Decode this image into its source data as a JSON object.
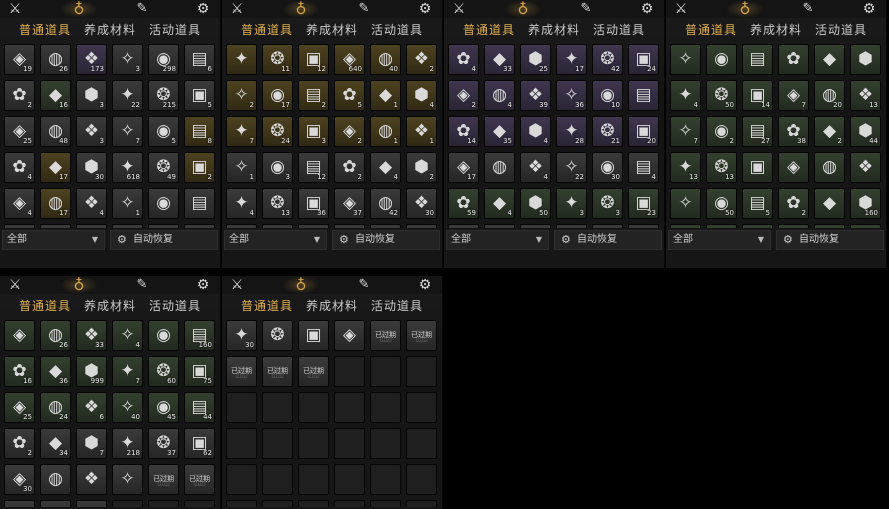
{
  "header_icons": [
    "crossed-swords-icon",
    "pouch-icon",
    "quill-icon",
    "gear-icon"
  ],
  "tabs": [
    "普通道具",
    "养成材料",
    "活动道具"
  ],
  "footer": {
    "filter_label": "全部",
    "restore_label": "自动恢复"
  },
  "expired_label": "已过期",
  "colors": {
    "gray": "#3a3a3a",
    "green": "#33402f",
    "purple": "#40364f",
    "gold": "#4d4220",
    "accent": "#e0b050"
  },
  "panels": [
    {
      "id": "p1",
      "rows": [
        [
          [
            "gray",
            "1",
            "19"
          ],
          [
            "gray",
            "",
            "26"
          ],
          [
            "purple",
            "",
            "173"
          ],
          [
            "gray",
            "",
            "3"
          ],
          [
            "gray",
            "",
            "298"
          ],
          [
            "gray",
            "",
            "6"
          ]
        ],
        [
          [
            "gray",
            "",
            "2"
          ],
          [
            "green",
            "",
            "16"
          ],
          [
            "gray",
            "",
            "3"
          ],
          [
            "gray",
            "",
            "22"
          ],
          [
            "gray",
            "",
            "215"
          ],
          [
            "gray",
            "",
            "5"
          ]
        ],
        [
          [
            "gray",
            "",
            "25"
          ],
          [
            "gray",
            "",
            "48"
          ],
          [
            "gray",
            "",
            "3"
          ],
          [
            "gray",
            "",
            "7"
          ],
          [
            "gray",
            "",
            "5"
          ],
          [
            "gold",
            "",
            "8"
          ]
        ],
        [
          [
            "gray",
            "",
            "4"
          ],
          [
            "gold",
            "",
            "17"
          ],
          [
            "gray",
            "",
            "30"
          ],
          [
            "gray",
            "",
            "618"
          ],
          [
            "gray",
            "",
            "49"
          ],
          [
            "gold",
            "",
            "2"
          ]
        ],
        [
          [
            "gray",
            "",
            "4"
          ],
          [
            "gold",
            "",
            "17"
          ],
          [
            "gray",
            "",
            "4"
          ],
          [
            "gray",
            "",
            "1"
          ],
          [
            "gray",
            "",
            ""
          ],
          [
            "gray",
            "",
            ""
          ]
        ],
        [
          [
            "gray",
            "",
            ""
          ],
          [
            "gray",
            "",
            ""
          ],
          [
            "gray",
            "",
            ""
          ],
          [
            "gray",
            "",
            ""
          ],
          [
            "gray",
            "",
            ""
          ],
          [
            "gray",
            "",
            ""
          ]
        ]
      ]
    },
    {
      "id": "p2",
      "rows": [
        [
          [
            "gold",
            "",
            ""
          ],
          [
            "gold",
            "",
            "11"
          ],
          [
            "gold",
            "",
            "12"
          ],
          [
            "gold",
            "",
            "640"
          ],
          [
            "gold",
            "",
            "40"
          ],
          [
            "gold",
            "",
            "2"
          ]
        ],
        [
          [
            "gold",
            "",
            "2"
          ],
          [
            "gold",
            "",
            "17"
          ],
          [
            "gold",
            "",
            "2"
          ],
          [
            "gold",
            "",
            "5"
          ],
          [
            "gold",
            "",
            "1"
          ],
          [
            "gold",
            "",
            "4"
          ]
        ],
        [
          [
            "gold",
            "",
            "7"
          ],
          [
            "gold",
            "",
            "24"
          ],
          [
            "gold",
            "",
            "3"
          ],
          [
            "gold",
            "",
            "2"
          ],
          [
            "gold",
            "",
            "1"
          ],
          [
            "gold",
            "",
            "1"
          ]
        ],
        [
          [
            "gray",
            "",
            "1"
          ],
          [
            "gray",
            "",
            "3"
          ],
          [
            "gray",
            "",
            "12"
          ],
          [
            "gray",
            "",
            "2"
          ],
          [
            "gray",
            "",
            "4"
          ],
          [
            "gray",
            "",
            "2"
          ]
        ],
        [
          [
            "gray",
            "",
            "4"
          ],
          [
            "gray",
            "",
            "13"
          ],
          [
            "gray",
            "",
            "36"
          ],
          [
            "gray",
            "",
            "37"
          ],
          [
            "gray",
            "",
            "42"
          ],
          [
            "gray",
            "",
            "30"
          ]
        ],
        [
          [
            "gray",
            "",
            "4"
          ],
          [
            "gray",
            "",
            "3"
          ],
          [
            "gray",
            "",
            "5"
          ],
          [
            "gray",
            "",
            "4"
          ],
          [
            "gray",
            "",
            "4"
          ],
          [
            "gray",
            "",
            "10"
          ]
        ]
      ]
    },
    {
      "id": "p3",
      "rows": [
        [
          [
            "purple",
            "",
            "4"
          ],
          [
            "purple",
            "",
            "33"
          ],
          [
            "purple",
            "",
            "25"
          ],
          [
            "purple",
            "",
            "17"
          ],
          [
            "purple",
            "",
            "42"
          ],
          [
            "purple",
            "",
            "24"
          ]
        ],
        [
          [
            "purple",
            "",
            "2"
          ],
          [
            "purple",
            "",
            "4"
          ],
          [
            "purple",
            "",
            "39"
          ],
          [
            "purple",
            "",
            "36"
          ],
          [
            "purple",
            "",
            "10"
          ],
          [
            "purple",
            "",
            ""
          ]
        ],
        [
          [
            "purple",
            "",
            "14"
          ],
          [
            "purple",
            "",
            "35"
          ],
          [
            "purple",
            "",
            "4"
          ],
          [
            "purple",
            "",
            "28"
          ],
          [
            "purple",
            "",
            "21"
          ],
          [
            "purple",
            "",
            "20"
          ]
        ],
        [
          [
            "gray",
            "",
            "17"
          ],
          [
            "gray",
            "",
            ""
          ],
          [
            "gray",
            "",
            "4"
          ],
          [
            "gray",
            "",
            "22"
          ],
          [
            "gray",
            "",
            "30"
          ],
          [
            "gray",
            "",
            "4"
          ]
        ],
        [
          [
            "green",
            "",
            "59"
          ],
          [
            "green",
            "",
            "4"
          ],
          [
            "green",
            "",
            "50"
          ],
          [
            "green",
            "",
            "3"
          ],
          [
            "green",
            "",
            "3"
          ],
          [
            "green",
            "",
            "23"
          ]
        ],
        [
          [
            "gray",
            "",
            ""
          ],
          [
            "gray",
            "",
            ""
          ],
          [
            "gray",
            "",
            ""
          ],
          [
            "gray",
            "",
            ""
          ],
          [
            "gray",
            "",
            ""
          ],
          [
            "gray",
            "",
            ""
          ]
        ]
      ]
    },
    {
      "id": "p4",
      "rows": [
        [
          [
            "green",
            "",
            ""
          ],
          [
            "green",
            "",
            ""
          ],
          [
            "green",
            "",
            ""
          ],
          [
            "green",
            "",
            ""
          ],
          [
            "green",
            "",
            ""
          ],
          [
            "green",
            "",
            ""
          ]
        ],
        [
          [
            "green",
            "",
            "4"
          ],
          [
            "green",
            "",
            "50"
          ],
          [
            "green",
            "",
            "14"
          ],
          [
            "green",
            "",
            "7"
          ],
          [
            "green",
            "",
            "20"
          ],
          [
            "green",
            "",
            "13"
          ]
        ],
        [
          [
            "green",
            "",
            "7"
          ],
          [
            "green",
            "",
            "2"
          ],
          [
            "green",
            "",
            "27"
          ],
          [
            "green",
            "",
            "38"
          ],
          [
            "green",
            "",
            "2"
          ],
          [
            "green",
            "",
            "44"
          ]
        ],
        [
          [
            "green",
            "",
            "13"
          ],
          [
            "green",
            "",
            "13"
          ],
          [
            "green",
            "",
            ""
          ],
          [
            "green",
            "",
            ""
          ],
          [
            "green",
            "",
            ""
          ],
          [
            "green",
            "",
            ""
          ]
        ],
        [
          [
            "green",
            "",
            ""
          ],
          [
            "green",
            "",
            "50"
          ],
          [
            "green",
            "",
            "5"
          ],
          [
            "green",
            "",
            "2"
          ],
          [
            "green",
            "",
            ""
          ],
          [
            "green",
            "",
            "160"
          ]
        ],
        [
          [
            "green",
            "",
            "16"
          ],
          [
            "green",
            "",
            "36"
          ],
          [
            "green",
            "",
            "999"
          ],
          [
            "green",
            "",
            "7"
          ],
          [
            "green",
            "",
            "60"
          ],
          [
            "green",
            "",
            "75"
          ]
        ]
      ]
    },
    {
      "id": "p5",
      "rows": [
        [
          [
            "green",
            "",
            ""
          ],
          [
            "green",
            "",
            "26"
          ],
          [
            "green",
            "",
            "33"
          ],
          [
            "green",
            "",
            "4"
          ],
          [
            "green",
            "",
            ""
          ],
          [
            "green",
            "",
            "160"
          ]
        ],
        [
          [
            "green",
            "",
            "16"
          ],
          [
            "green",
            "",
            "36"
          ],
          [
            "green",
            "",
            "999"
          ],
          [
            "green",
            "",
            "7"
          ],
          [
            "green",
            "",
            "60"
          ],
          [
            "green",
            "",
            "75"
          ]
        ],
        [
          [
            "green",
            "",
            "25"
          ],
          [
            "green",
            "",
            "24"
          ],
          [
            "green",
            "",
            "6"
          ],
          [
            "green",
            "",
            "40"
          ],
          [
            "green",
            "",
            "45"
          ],
          [
            "green",
            "",
            "44"
          ]
        ],
        [
          [
            "gray",
            "",
            "2"
          ],
          [
            "gray",
            "",
            "34"
          ],
          [
            "gray",
            "",
            "7"
          ],
          [
            "gray",
            "",
            "218"
          ],
          [
            "gray",
            "",
            "37"
          ],
          [
            "gray",
            "",
            "62"
          ]
        ],
        [
          [
            "gray",
            "",
            "30"
          ],
          [
            "gray",
            "",
            ""
          ],
          [
            "gray",
            "",
            ""
          ],
          [
            "gray",
            "",
            ""
          ],
          [
            "expired",
            "",
            ""
          ],
          [
            "expired",
            "",
            ""
          ]
        ],
        [
          [
            "expired",
            "",
            ""
          ],
          [
            "expired",
            "",
            ""
          ],
          [
            "expired",
            "",
            ""
          ],
          [
            "empty",
            "",
            ""
          ],
          [
            "empty",
            "",
            ""
          ],
          [
            "empty",
            "",
            ""
          ]
        ]
      ]
    },
    {
      "id": "p6",
      "rows": [
        [
          [
            "gray",
            "",
            "30"
          ],
          [
            "gray",
            "",
            ""
          ],
          [
            "gray",
            "",
            ""
          ],
          [
            "gray",
            "",
            ""
          ],
          [
            "expired",
            "",
            ""
          ],
          [
            "expired",
            "",
            ""
          ]
        ],
        [
          [
            "expired",
            "",
            ""
          ],
          [
            "expired",
            "",
            ""
          ],
          [
            "expired",
            "",
            ""
          ],
          [
            "empty",
            "",
            ""
          ],
          [
            "empty",
            "",
            ""
          ],
          [
            "empty",
            "",
            ""
          ]
        ],
        [
          [
            "empty",
            "",
            ""
          ],
          [
            "empty",
            "",
            ""
          ],
          [
            "empty",
            "",
            ""
          ],
          [
            "empty",
            "",
            ""
          ],
          [
            "empty",
            "",
            ""
          ],
          [
            "empty",
            "",
            ""
          ]
        ],
        [
          [
            "empty",
            "",
            ""
          ],
          [
            "empty",
            "",
            ""
          ],
          [
            "empty",
            "",
            ""
          ],
          [
            "empty",
            "",
            ""
          ],
          [
            "empty",
            "",
            ""
          ],
          [
            "empty",
            "",
            ""
          ]
        ],
        [
          [
            "empty",
            "",
            ""
          ],
          [
            "empty",
            "",
            ""
          ],
          [
            "empty",
            "",
            ""
          ],
          [
            "empty",
            "",
            ""
          ],
          [
            "empty",
            "",
            ""
          ],
          [
            "empty",
            "",
            ""
          ]
        ],
        [
          [
            "empty",
            "",
            ""
          ],
          [
            "empty",
            "",
            ""
          ],
          [
            "empty",
            "",
            ""
          ],
          [
            "empty",
            "",
            ""
          ],
          [
            "empty",
            "",
            ""
          ],
          [
            "empty",
            "",
            ""
          ]
        ]
      ]
    }
  ]
}
